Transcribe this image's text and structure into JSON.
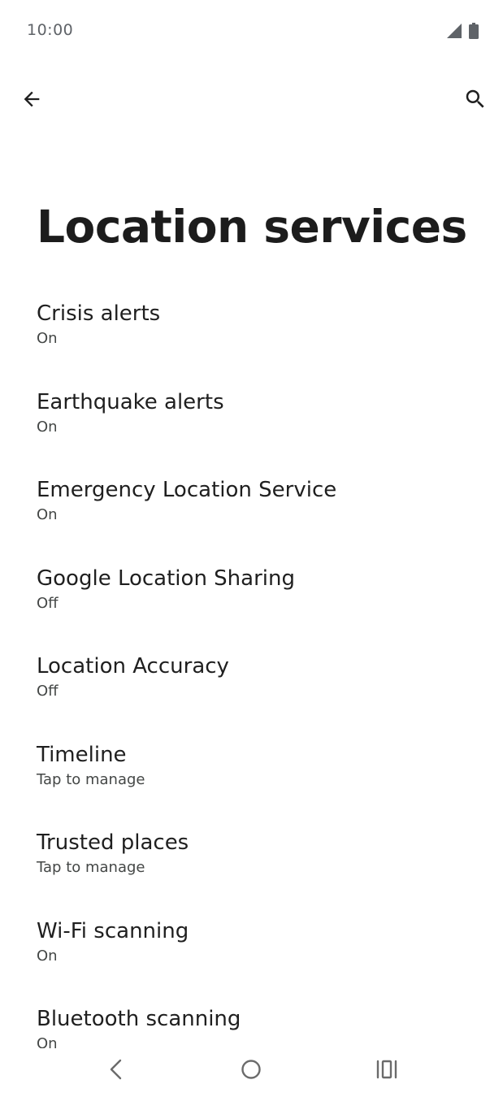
{
  "status_bar": {
    "time": "10:00",
    "icons": [
      "cellular-signal-icon",
      "battery-icon"
    ]
  },
  "toolbar": {
    "back_icon": "back-arrow-icon",
    "search_icon": "search-icon"
  },
  "page": {
    "title": "Location services"
  },
  "items": [
    {
      "title": "Crisis alerts",
      "summary": "On"
    },
    {
      "title": "Earthquake alerts",
      "summary": "On"
    },
    {
      "title": "Emergency Location Service",
      "summary": "On"
    },
    {
      "title": "Google Location Sharing",
      "summary": "Off"
    },
    {
      "title": "Location Accuracy",
      "summary": "Off"
    },
    {
      "title": "Timeline",
      "summary": "Tap to manage"
    },
    {
      "title": "Trusted places",
      "summary": "Tap to manage"
    },
    {
      "title": "Wi-Fi scanning",
      "summary": "On"
    },
    {
      "title": "Bluetooth scanning",
      "summary": "On"
    }
  ],
  "nav_bar": {
    "icons": [
      "nav-back-icon",
      "nav-home-icon",
      "nav-recents-icon"
    ]
  }
}
